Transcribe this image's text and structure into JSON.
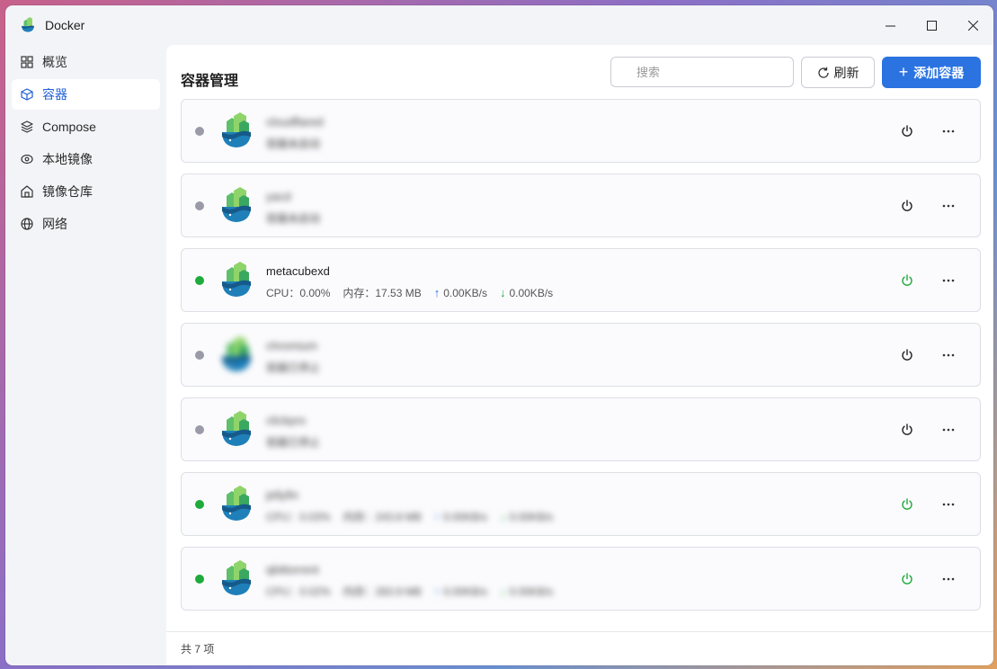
{
  "window": {
    "title": "Docker"
  },
  "sidebar": {
    "items": [
      {
        "label": "概览",
        "icon": "grid-icon"
      },
      {
        "label": "容器",
        "icon": "cube-icon",
        "active": true
      },
      {
        "label": "Compose",
        "icon": "layers-icon"
      },
      {
        "label": "本地镜像",
        "icon": "disc-icon"
      },
      {
        "label": "镜像仓库",
        "icon": "home-icon"
      },
      {
        "label": "网络",
        "icon": "globe-icon"
      }
    ]
  },
  "header": {
    "title": "容器管理",
    "search_placeholder": "搜索",
    "refresh_label": "刷新",
    "add_label": "添加容器"
  },
  "containers": [
    {
      "name": "cloudflared",
      "status": "stopped",
      "status_text": "容器未启动",
      "blurred": true
    },
    {
      "name": "yacd",
      "status": "stopped",
      "status_text": "容器未启动",
      "blurred": true
    },
    {
      "name": "metacubexd",
      "status": "running",
      "cpu": "CPU：0.00%",
      "mem": "内存：17.53 MB",
      "up": "0.00KB/s",
      "down": "0.00KB/s",
      "blurred": false
    },
    {
      "name": "chromium",
      "status": "stopped",
      "status_text": "容器已停止",
      "blurred": true
    },
    {
      "name": "clickpro",
      "status": "stopped",
      "status_text": "容器已停止",
      "blurred": true
    },
    {
      "name": "jellyfin",
      "status": "running",
      "cpu": "CPU：0.03%",
      "mem": "内存：243.8 MB",
      "up": "0.00KB/s",
      "down": "0.00KB/s",
      "blurred": true
    },
    {
      "name": "qbittorrent",
      "status": "running",
      "cpu": "CPU：0.02%",
      "mem": "内存：283.9 MB",
      "up": "0.00KB/s",
      "down": "0.00KB/s",
      "blurred": true
    }
  ],
  "footer": {
    "count_text": "共 7 项"
  },
  "colors": {
    "accent": "#2a73e0",
    "running": "#1faa3c",
    "stopped": "#9a9aa8"
  }
}
